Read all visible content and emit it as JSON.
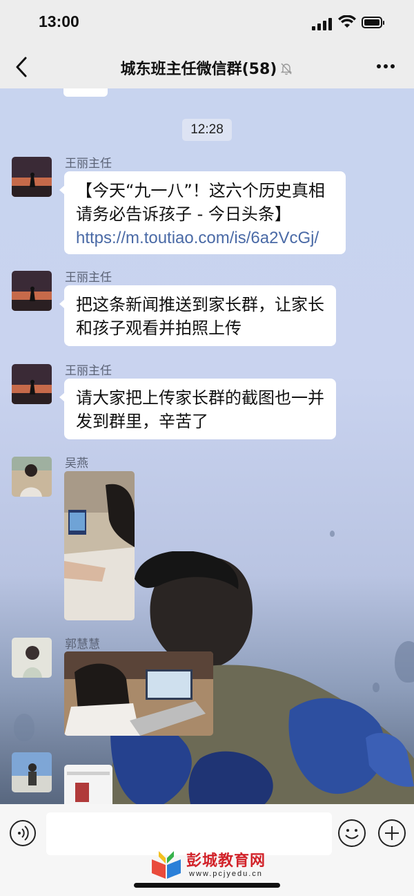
{
  "status": {
    "time": "13:00"
  },
  "header": {
    "title": "城东班主任微信群(58)"
  },
  "time_divider": "12:28",
  "messages": [
    {
      "sender": "王丽主任",
      "text": "【今天“九一八”！这六个历史真相请务必告诉孩子 - 今日头条】",
      "link": "https://m.toutiao.com/is/6a2VcGj/"
    },
    {
      "sender": "王丽主任",
      "text": "把这条新闻推送到家长群，让家长和孩子观看并拍照上传"
    },
    {
      "sender": "王丽主任",
      "text": "请大家把上传家长群的截图也一并发到群里，辛苦了"
    },
    {
      "sender": "吴燕",
      "type": "image"
    },
    {
      "sender": "郭慧慧",
      "type": "image"
    },
    {
      "sender": "",
      "type": "image"
    }
  ],
  "watermark": {
    "name": "彭城教育网",
    "url": "www.pcjyedu.cn"
  },
  "colors": {
    "bar_bg": "#ededed",
    "link": "#4a6aa6",
    "watermark": "#d2232a"
  }
}
